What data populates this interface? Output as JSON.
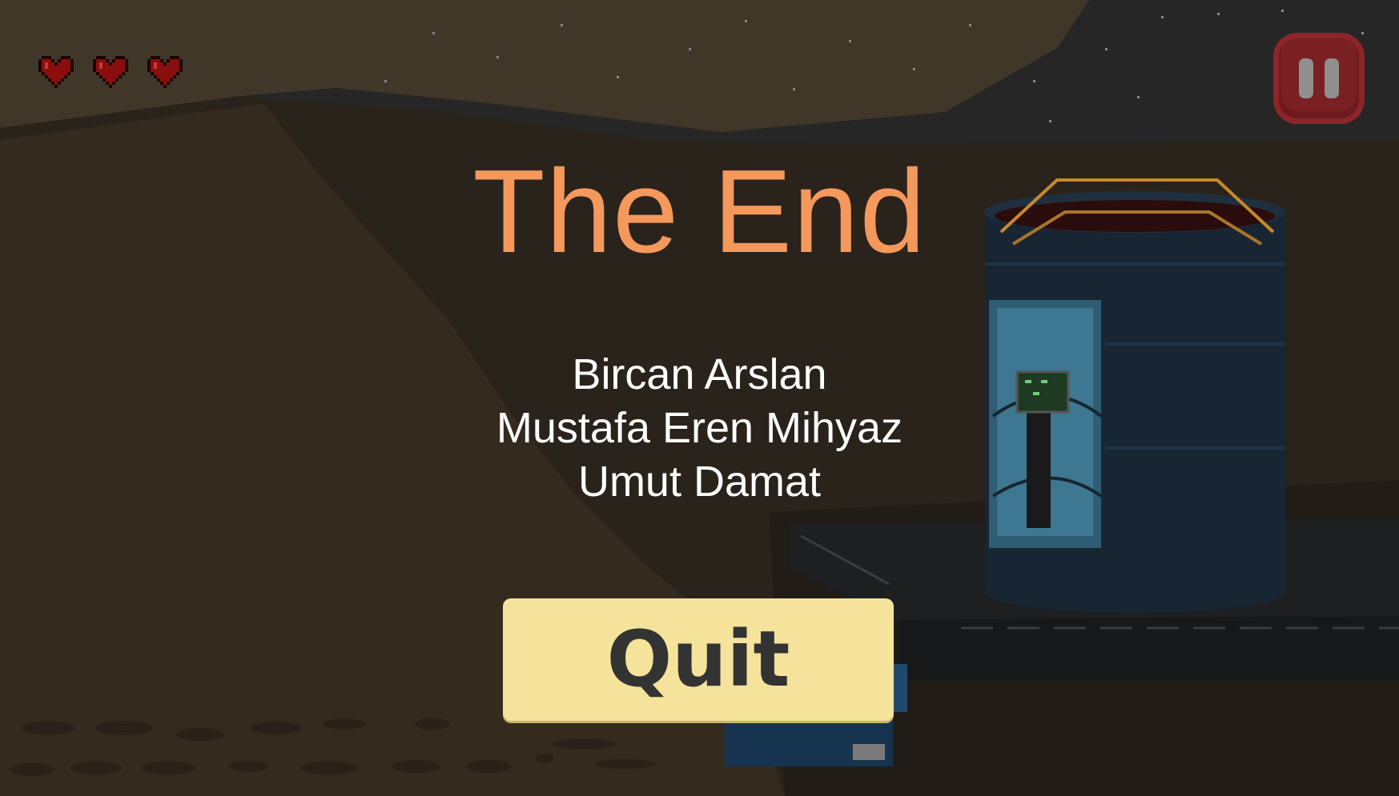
{
  "hud": {
    "lives": 3,
    "heart_icon": "heart-icon",
    "pause_icon": "pause-icon"
  },
  "end_screen": {
    "title": "The End",
    "credits": [
      "Bircan Arslan",
      "Mustafa Eren Mihyaz",
      "Umut Damat"
    ],
    "quit_label": "Quit"
  },
  "colors": {
    "title": "#f4985c",
    "credits_text": "#ffffff",
    "quit_button_bg": "#f5e39b",
    "quit_button_text": "#333333",
    "pause_button_bg": "#7a1f22",
    "heart_red": "#8b0e0e"
  }
}
